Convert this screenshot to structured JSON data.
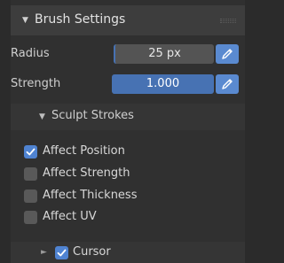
{
  "panel": {
    "title": "Brush Settings",
    "collapse_glyph": "▼",
    "grip_icon": "grip-dots-icon"
  },
  "radius": {
    "label": "Radius",
    "value": "25 px",
    "icon": "pen-pressure-icon"
  },
  "strength": {
    "label": "Strength",
    "value": "1.000",
    "icon": "pen-pressure-icon"
  },
  "sculpt_strokes": {
    "title": "Sculpt Strokes",
    "collapse_glyph": "▼",
    "options": [
      {
        "label": "Affect Position",
        "checked": true
      },
      {
        "label": "Affect Strength",
        "checked": false
      },
      {
        "label": "Affect Thickness",
        "checked": false
      },
      {
        "label": "Affect UV",
        "checked": false
      }
    ]
  },
  "cursor": {
    "label": "Cursor",
    "checked": true,
    "expand_glyph": "►"
  },
  "colors": {
    "accent": "#4772b3",
    "checkbox_checked": "#4f83d1",
    "panel_bg": "#303030",
    "header_bg": "#3d3d3d"
  }
}
